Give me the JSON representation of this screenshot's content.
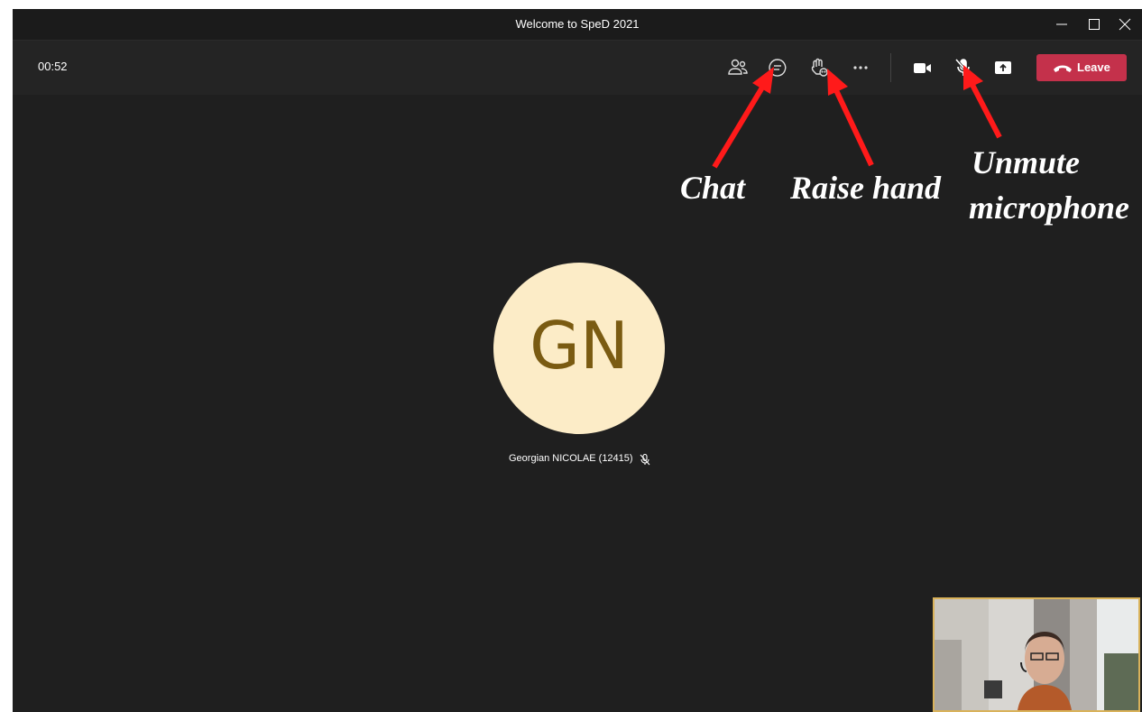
{
  "window": {
    "title": "Welcome to SpeD 2021",
    "controls": [
      "minimize-icon",
      "maximize-icon",
      "close-icon"
    ]
  },
  "toolbar": {
    "timer": "00:52",
    "buttons": [
      "participants-icon",
      "chat-icon",
      "raise-hand-icon",
      "more-actions-icon",
      "camera-icon",
      "mic-muted-icon",
      "share-screen-icon"
    ],
    "leave_label": "Leave"
  },
  "main": {
    "avatar_initials": "GN",
    "avatar_bg": "#fcecc7",
    "avatar_fg": "#7a5b12",
    "participant_name": "Georgian NICOLAE (12415)"
  },
  "annotations": {
    "chat": "Chat",
    "raise_hand": "Raise hand",
    "unmute_line1": "Unmute",
    "unmute_line2": "microphone",
    "arrow_color": "#ff1a1a"
  }
}
